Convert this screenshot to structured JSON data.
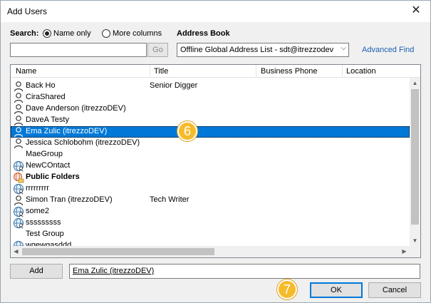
{
  "window": {
    "title": "Add Users",
    "close_glyph": "✕"
  },
  "search": {
    "label": "Search:",
    "options": [
      {
        "label": "Name only",
        "selected": true
      },
      {
        "label": "More columns",
        "selected": false
      }
    ],
    "input_value": "",
    "go_label": "Go"
  },
  "address_book": {
    "label": "Address Book",
    "selected": "Offline Global Address List - sdt@itrezzodev",
    "chevron": "⌵",
    "advanced_find": "Advanced Find"
  },
  "columns": [
    "Name",
    "Title",
    "Business Phone",
    "Location"
  ],
  "rows": [
    {
      "name": "Back Ho",
      "title": "Senior Digger",
      "icon": "user-icon"
    },
    {
      "name": "CiraShared",
      "title": "",
      "icon": "user-icon"
    },
    {
      "name": "Dave Anderson (itrezzoDEV)",
      "title": "",
      "icon": "user-icon"
    },
    {
      "name": "DaveA Testy",
      "title": "",
      "icon": "user-icon"
    },
    {
      "name": "Ema Zulic (itrezzoDEV)",
      "title": "",
      "icon": "user-icon",
      "selected": true
    },
    {
      "name": "Jessica Schlobohm (itrezzoDEV)",
      "title": "",
      "icon": "user-icon"
    },
    {
      "name": "MaeGroup",
      "title": "",
      "icon": "none"
    },
    {
      "name": "NewCOntact",
      "title": "",
      "icon": "globe-contact-icon"
    },
    {
      "name": "Public Folders",
      "title": "",
      "icon": "public-folder-icon",
      "bold": true
    },
    {
      "name": "rrrrrrrrr",
      "title": "",
      "icon": "globe-contact-icon"
    },
    {
      "name": "Simon Tran (itrezzoDEV)",
      "title": "Tech Writer",
      "icon": "user-icon"
    },
    {
      "name": "some2",
      "title": "",
      "icon": "globe-contact-icon"
    },
    {
      "name": "sssssssss",
      "title": "",
      "icon": "globe-contact-icon"
    },
    {
      "name": "Test Group",
      "title": "",
      "icon": "none"
    },
    {
      "name": "wgewgasddd",
      "title": "",
      "icon": "globe-contact-icon"
    }
  ],
  "add": {
    "button_label": "Add",
    "value": "Ema Zulic (itrezzoDEV)"
  },
  "footer": {
    "ok_label": "OK",
    "cancel_label": "Cancel"
  },
  "callouts": {
    "step6": "6",
    "step7": "7"
  },
  "colors": {
    "selection": "#0078d7",
    "callout": "#f6bb2b",
    "link": "#1a5fb4"
  }
}
